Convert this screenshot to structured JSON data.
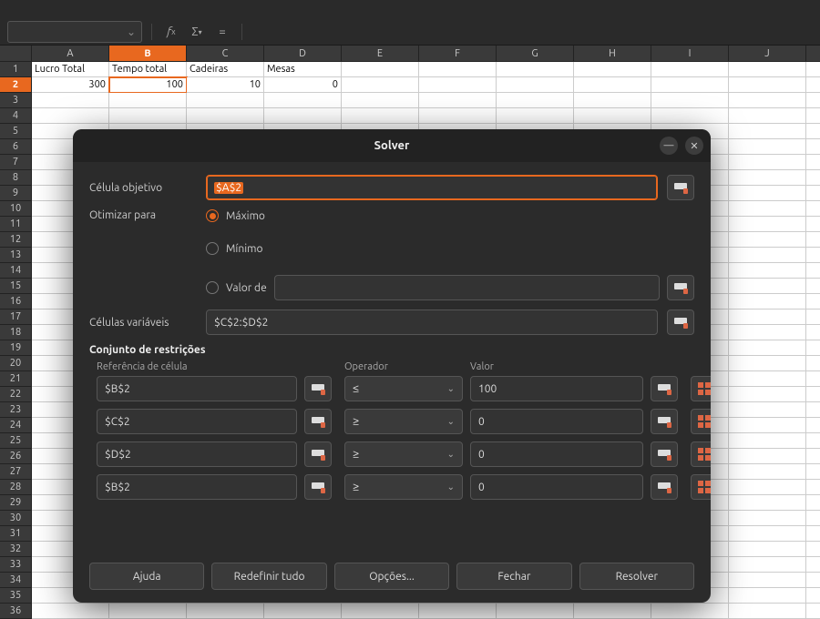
{
  "toolbar": {
    "namebox_value": "",
    "icons": [
      "fx",
      "Σ",
      "="
    ]
  },
  "sheet": {
    "columns": [
      "A",
      "B",
      "C",
      "D",
      "E",
      "F",
      "G",
      "H",
      "I",
      "J"
    ],
    "selected_col": "B",
    "selected_row": 2,
    "row_count": 36,
    "row1": {
      "A": "Lucro Total",
      "B": "Tempo total",
      "C": "Cadeiras",
      "D": "Mesas"
    },
    "row2": {
      "A": "300",
      "B": "100",
      "C": "10",
      "D": "0"
    }
  },
  "dialog": {
    "title": "Solver",
    "target_label": "Célula objetivo",
    "target_value": "$A$2",
    "optimize_label": "Otimizar para",
    "radios": {
      "max": "Máximo",
      "min": "Mínimo",
      "valueof": "Valor de"
    },
    "valueof_value": "",
    "vars_label": "Células variáveis",
    "vars_value": "$C$2:$D$2",
    "constraints_title": "Conjunto de restrições",
    "col_ref": "Referência de célula",
    "col_op": "Operador",
    "col_val": "Valor",
    "constraints": [
      {
        "ref": "$B$2",
        "op": "≤",
        "val": "100"
      },
      {
        "ref": "$C$2",
        "op": "≥",
        "val": "0"
      },
      {
        "ref": "$D$2",
        "op": "≥",
        "val": "0"
      },
      {
        "ref": "$B$2",
        "op": "≥",
        "val": "0"
      }
    ],
    "buttons": {
      "help": "Ajuda",
      "reset": "Redefinir tudo",
      "options": "Opções...",
      "close": "Fechar",
      "solve": "Resolver"
    }
  }
}
